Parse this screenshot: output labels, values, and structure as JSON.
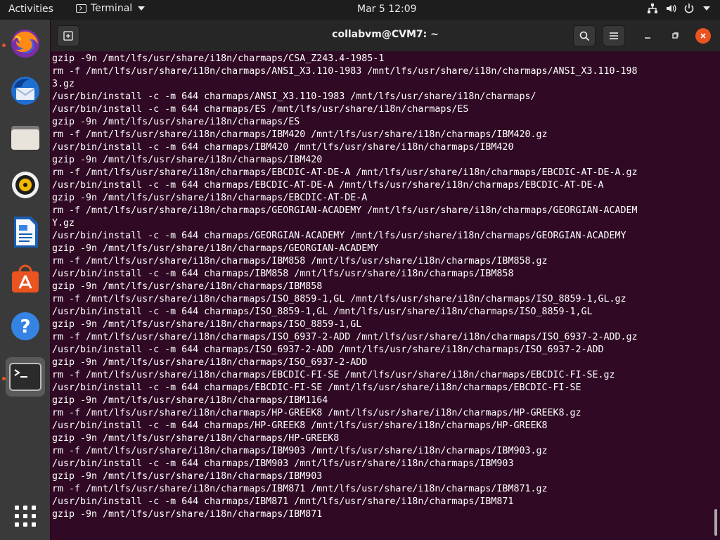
{
  "topbar": {
    "activities": "Activities",
    "app_name": "Terminal",
    "clock": "Mar 5  12:09"
  },
  "dock": {
    "items": [
      {
        "name": "firefox",
        "icon": "firefox-icon",
        "running": true
      },
      {
        "name": "thunderbird",
        "icon": "thunderbird-icon",
        "running": false
      },
      {
        "name": "files",
        "icon": "files-icon",
        "running": false
      },
      {
        "name": "rhythmbox",
        "icon": "rhythmbox-icon",
        "running": false
      },
      {
        "name": "libreoffice-writer",
        "icon": "writer-icon",
        "running": false
      },
      {
        "name": "ubuntu-software",
        "icon": "software-icon",
        "running": false
      },
      {
        "name": "help",
        "icon": "help-icon",
        "running": false
      },
      {
        "name": "terminal",
        "icon": "terminal-icon",
        "running": true
      }
    ],
    "show_apps_icon": "grid-icon"
  },
  "window": {
    "title": "collabvm@CVM7: ~"
  },
  "terminal": {
    "lines": [
      "gzip -9n /mnt/lfs/usr/share/i18n/charmaps/CSA_Z243.4-1985-1",
      "rm -f /mnt/lfs/usr/share/i18n/charmaps/ANSI_X3.110-1983 /mnt/lfs/usr/share/i18n/charmaps/ANSI_X3.110-198",
      "3.gz",
      "/usr/bin/install -c -m 644 charmaps/ANSI_X3.110-1983 /mnt/lfs/usr/share/i18n/charmaps/",
      "/usr/bin/install -c -m 644 charmaps/ES /mnt/lfs/usr/share/i18n/charmaps/ES",
      "gzip -9n /mnt/lfs/usr/share/i18n/charmaps/ES",
      "rm -f /mnt/lfs/usr/share/i18n/charmaps/IBM420 /mnt/lfs/usr/share/i18n/charmaps/IBM420.gz",
      "/usr/bin/install -c -m 644 charmaps/IBM420 /mnt/lfs/usr/share/i18n/charmaps/IBM420",
      "gzip -9n /mnt/lfs/usr/share/i18n/charmaps/IBM420",
      "rm -f /mnt/lfs/usr/share/i18n/charmaps/EBCDIC-AT-DE-A /mnt/lfs/usr/share/i18n/charmaps/EBCDIC-AT-DE-A.gz",
      "/usr/bin/install -c -m 644 charmaps/EBCDIC-AT-DE-A /mnt/lfs/usr/share/i18n/charmaps/EBCDIC-AT-DE-A",
      "gzip -9n /mnt/lfs/usr/share/i18n/charmaps/EBCDIC-AT-DE-A",
      "rm -f /mnt/lfs/usr/share/i18n/charmaps/GEORGIAN-ACADEMY /mnt/lfs/usr/share/i18n/charmaps/GEORGIAN-ACADEM",
      "Y.gz",
      "/usr/bin/install -c -m 644 charmaps/GEORGIAN-ACADEMY /mnt/lfs/usr/share/i18n/charmaps/GEORGIAN-ACADEMY",
      "gzip -9n /mnt/lfs/usr/share/i18n/charmaps/GEORGIAN-ACADEMY",
      "rm -f /mnt/lfs/usr/share/i18n/charmaps/IBM858 /mnt/lfs/usr/share/i18n/charmaps/IBM858.gz",
      "/usr/bin/install -c -m 644 charmaps/IBM858 /mnt/lfs/usr/share/i18n/charmaps/IBM858",
      "gzip -9n /mnt/lfs/usr/share/i18n/charmaps/IBM858",
      "rm -f /mnt/lfs/usr/share/i18n/charmaps/ISO_8859-1,GL /mnt/lfs/usr/share/i18n/charmaps/ISO_8859-1,GL.gz",
      "/usr/bin/install -c -m 644 charmaps/ISO_8859-1,GL /mnt/lfs/usr/share/i18n/charmaps/ISO_8859-1,GL",
      "gzip -9n /mnt/lfs/usr/share/i18n/charmaps/ISO_8859-1,GL",
      "rm -f /mnt/lfs/usr/share/i18n/charmaps/ISO_6937-2-ADD /mnt/lfs/usr/share/i18n/charmaps/ISO_6937-2-ADD.gz",
      "/usr/bin/install -c -m 644 charmaps/ISO_6937-2-ADD /mnt/lfs/usr/share/i18n/charmaps/ISO_6937-2-ADD",
      "gzip -9n /mnt/lfs/usr/share/i18n/charmaps/ISO_6937-2-ADD",
      "rm -f /mnt/lfs/usr/share/i18n/charmaps/EBCDIC-FI-SE /mnt/lfs/usr/share/i18n/charmaps/EBCDIC-FI-SE.gz",
      "/usr/bin/install -c -m 644 charmaps/EBCDIC-FI-SE /mnt/lfs/usr/share/i18n/charmaps/EBCDIC-FI-SE",
      "gzip -9n /mnt/lfs/usr/share/i18n/charmaps/IBM1164",
      "rm -f /mnt/lfs/usr/share/i18n/charmaps/HP-GREEK8 /mnt/lfs/usr/share/i18n/charmaps/HP-GREEK8.gz",
      "/usr/bin/install -c -m 644 charmaps/HP-GREEK8 /mnt/lfs/usr/share/i18n/charmaps/HP-GREEK8",
      "gzip -9n /mnt/lfs/usr/share/i18n/charmaps/HP-GREEK8",
      "rm -f /mnt/lfs/usr/share/i18n/charmaps/IBM903 /mnt/lfs/usr/share/i18n/charmaps/IBM903.gz",
      "/usr/bin/install -c -m 644 charmaps/IBM903 /mnt/lfs/usr/share/i18n/charmaps/IBM903",
      "gzip -9n /mnt/lfs/usr/share/i18n/charmaps/IBM903",
      "rm -f /mnt/lfs/usr/share/i18n/charmaps/IBM871 /mnt/lfs/usr/share/i18n/charmaps/IBM871.gz",
      "/usr/bin/install -c -m 644 charmaps/IBM871 /mnt/lfs/usr/share/i18n/charmaps/IBM871",
      "gzip -9n /mnt/lfs/usr/share/i18n/charmaps/IBM871"
    ]
  },
  "colors": {
    "terminal_bg": "#300a24",
    "accent": "#e95420",
    "topbar_bg": "#1d1d1d",
    "dock_bg": "#3a3a3a"
  }
}
